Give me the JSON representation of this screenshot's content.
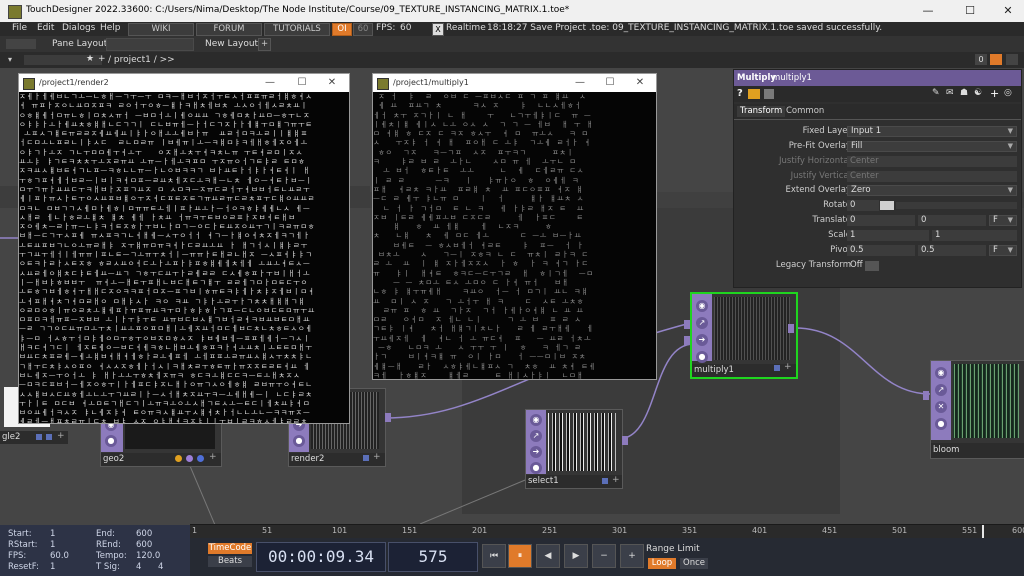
{
  "window": {
    "title": "TouchDesigner 2022.33600: C:/Users/Nima/Desktop/The Node Institute/Course/09_TEXTURE_INSTANCING_MATRIX.1.toe*",
    "minimize": "—",
    "maximize": "☐",
    "close": "✕"
  },
  "menu": {
    "items": [
      "File",
      "Edit",
      "Dialogs",
      "Help"
    ],
    "wiki": "WIKI",
    "forum": "FORUM",
    "tutorials": "TUTORIALS",
    "oi_badge": "OI",
    "fps_target": "60",
    "fps_label": "FPS:",
    "fps_value": "60",
    "realtime_check": "X",
    "realtime_label": "Realtime",
    "status_message": "18:18:27 Save Project .toe: 09_TEXTURE_INSTANCING_MATRIX.1.toe saved successfully."
  },
  "panebar": {
    "pane_layout": "Pane Layout",
    "new_layout": "New Layout",
    "plus": "+"
  },
  "pathbar": {
    "path": "/ project1 / >>",
    "counter": "0"
  },
  "viewer_render2": {
    "title": "/project1/render2"
  },
  "viewer_multiply1": {
    "title": "/project1/multiply1"
  },
  "params": {
    "op_type": "Multiply",
    "op_name": "multiply1",
    "tabs": [
      "Transform",
      "Common"
    ],
    "rows": [
      {
        "label": "Fixed Layer",
        "value": "Input 1",
        "kind": "drop"
      },
      {
        "label": "Pre-Fit Overlay",
        "value": "Fill",
        "kind": "drop"
      },
      {
        "label": "Justify Horizontal",
        "value": "Center",
        "kind": "disabled"
      },
      {
        "label": "Justify Vertical",
        "value": "Center",
        "kind": "disabled"
      },
      {
        "label": "Extend Overlay",
        "value": "Zero",
        "kind": "drop"
      },
      {
        "label": "Rotate",
        "value": "0",
        "kind": "slider"
      },
      {
        "label": "Translate",
        "value": "0",
        "value2": "0",
        "unit": "F",
        "kind": "pair"
      },
      {
        "label": "Scale",
        "value": "1",
        "value2": "1",
        "kind": "pair"
      },
      {
        "label": "Pivot",
        "value": "0.5",
        "value2": "0.5",
        "unit": "F",
        "kind": "pair"
      },
      {
        "label": "Legacy Transform",
        "value": "Off",
        "kind": "toggle"
      }
    ]
  },
  "nodes": {
    "multiply1": "multiply1",
    "select1": "select1",
    "geo2": "geo2",
    "render2": "render2",
    "bloom": "bloom",
    "circle_partial": "gle2"
  },
  "timeline": {
    "ticks": [
      "1",
      "51",
      "101",
      "151",
      "201",
      "251",
      "301",
      "351",
      "401",
      "451",
      "501",
      "551",
      "600"
    ]
  },
  "info": {
    "start_label": "Start:",
    "start": "1",
    "end_label": "End:",
    "end": "600",
    "rstart_label": "RStart:",
    "rstart": "1",
    "rend_label": "REnd:",
    "rend": "600",
    "fps_label": "FPS:",
    "fps": "60.0",
    "tempo_label": "Tempo:",
    "tempo": "120.0",
    "resetf_label": "ResetF:",
    "resetf": "1",
    "tsig_label": "T Sig:",
    "tsig_a": "4",
    "tsig_b": "4"
  },
  "playbar": {
    "timecode_btn": "TimeCode",
    "beats_btn": "Beats",
    "timecode": "00:00:09.34",
    "frame": "575",
    "range_limit": "Range Limit",
    "loop": "Loop",
    "once": "Once"
  },
  "colors": {
    "accent_orange": "#e07a2a",
    "node_purple": "#8d7bbd",
    "selected_green": "#1fd51f",
    "param_header": "#6c5a96"
  }
}
